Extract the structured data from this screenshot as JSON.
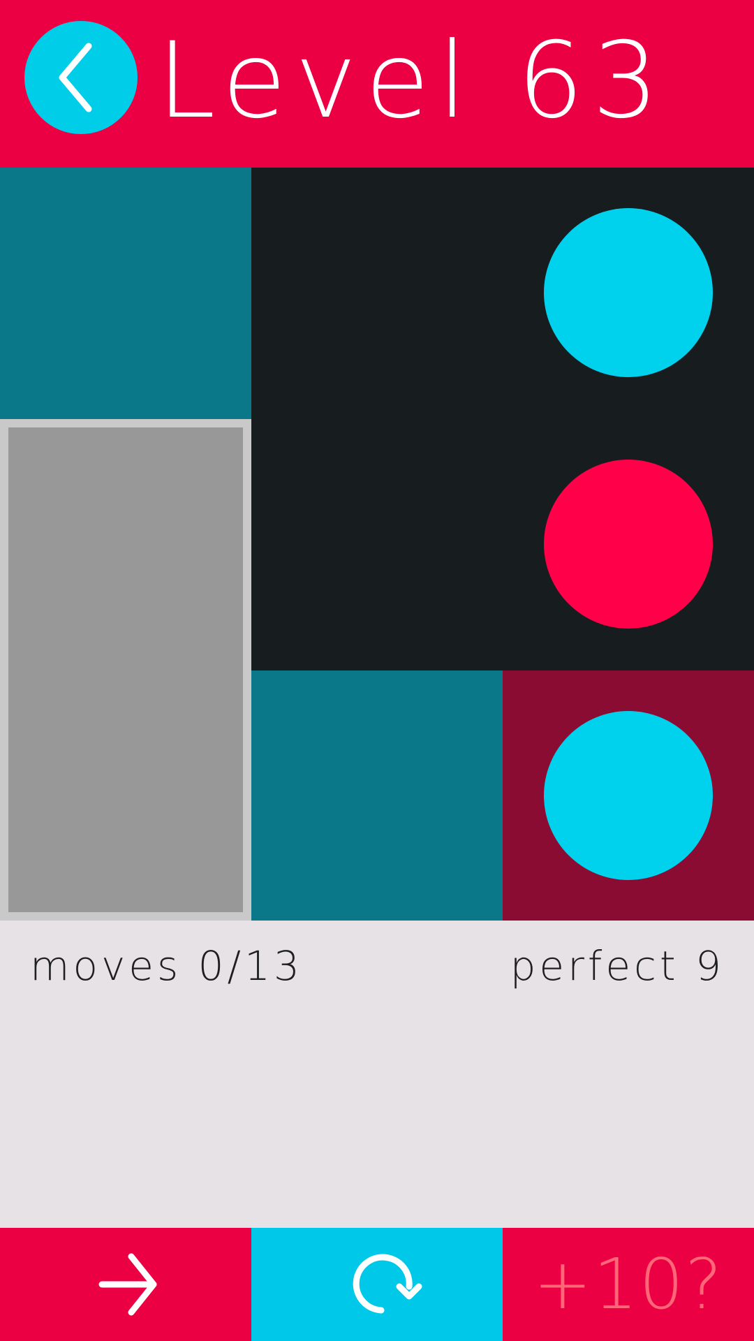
{
  "header": {
    "title": "Level 63",
    "back_icon": "chevron-left-icon",
    "color": "#ec0044"
  },
  "board": {
    "background": "#171c1f",
    "tiles": [
      {
        "type": "teal",
        "color": "#0a7888"
      },
      {
        "type": "gray-block",
        "color": "#989898"
      },
      {
        "type": "teal",
        "color": "#0a7888"
      },
      {
        "type": "maroon",
        "color": "#8a0c32"
      }
    ],
    "dots": [
      {
        "color": "cyan",
        "hex": "#00d2ee"
      },
      {
        "color": "red",
        "hex": "#ff0049"
      },
      {
        "color": "cyan",
        "hex": "#00d2ee"
      }
    ]
  },
  "stats": {
    "moves": "moves 0/13",
    "perfect": "perfect 9"
  },
  "footer": {
    "next_icon": "arrow-right-icon",
    "restart_icon": "restart-icon",
    "hint_label": "+10?"
  }
}
